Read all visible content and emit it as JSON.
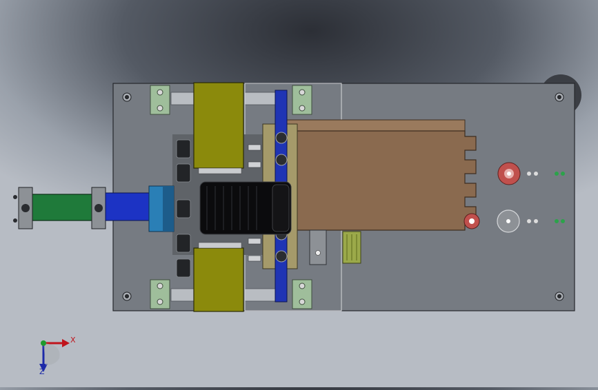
{
  "view": {
    "kind": "CAD model viewport (top view)",
    "background_top": "#2c2f36",
    "background_bottom": "#b7bcc4"
  },
  "triad": {
    "x_label": "X",
    "z_label": "Z",
    "x_color": "#c0141c",
    "z_color": "#1d2aa8",
    "origin_color": "#1f9a2e"
  },
  "colors": {
    "base_plate": "#767b82",
    "olive_block": "#8b8a0c",
    "copper_plate": "#8a6a4f",
    "blue_rail": "#1f34b4",
    "green_cylinder": "#1f7a3a",
    "blue_rod": "#1c33c4",
    "teal_collar": "#2a7fb6",
    "motor": "#0b0b0d",
    "pillow_block": "#9fbe9b",
    "red_wheel": "#c0504d"
  },
  "icons": [
    "axis-triad-icon"
  ]
}
